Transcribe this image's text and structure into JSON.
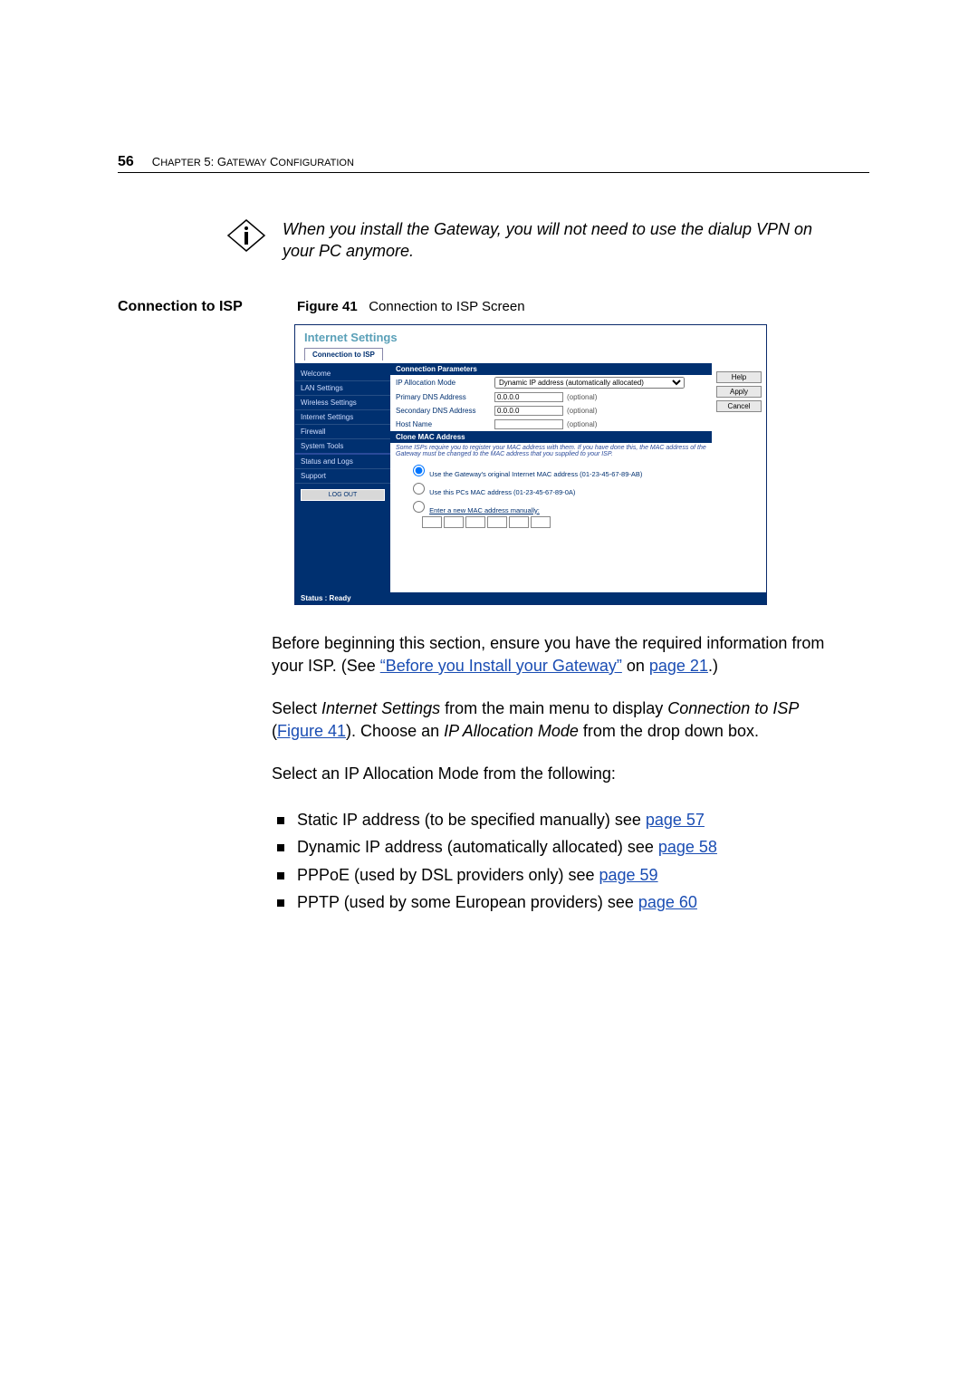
{
  "header": {
    "page_number": "56",
    "chapter_prefix": "C",
    "chapter_rest1": "HAPTER",
    "chapter_num": " 5: G",
    "chapter_rest2": "ATEWAY",
    "chapter_sp": " C",
    "chapter_rest3": "ONFIGURATION"
  },
  "info": {
    "text": "When you install the Gateway, you will not need to use the dialup VPN on your PC anymore."
  },
  "section": {
    "heading": "Connection to ISP",
    "figure_label": "Figure 41",
    "figure_caption": "Connection to ISP Screen"
  },
  "shot": {
    "title": "Internet Settings",
    "tab": "Connection to ISP",
    "sidebar": {
      "items": [
        "Welcome",
        "LAN Settings",
        "Wireless Settings",
        "Internet Settings",
        "Firewall",
        "System Tools"
      ],
      "items2": [
        "Status and Logs",
        "Support"
      ],
      "logout": "LOG OUT"
    },
    "sections": {
      "conn_params": "Connection Parameters",
      "clone_mac": "Clone MAC Address"
    },
    "rows": {
      "ip_mode_lab": "IP Allocation Mode",
      "ip_mode_val": "Dynamic IP address (automatically allocated)",
      "pdns_lab": "Primary DNS Address",
      "pdns_val": "0.0.0.0",
      "sdns_lab": "Secondary DNS Address",
      "sdns_val": "0.0.0.0",
      "host_lab": "Host Name",
      "optional": "(optional)"
    },
    "clone": {
      "note": "Some ISPs require you to register your MAC address with them. If you have done this, the MAC address of the Gateway must be changed to the MAC address that you supplied to your ISP.",
      "r1": "Use the Gateway's original Internet MAC address (01-23-45-67-89-AB)",
      "r2": "Use this PCs MAC address (01-23-45-67-89-0A)",
      "r3": "Enter a new MAC address manually:"
    },
    "buttons": {
      "help": "Help",
      "apply": "Apply",
      "cancel": "Cancel"
    },
    "status": "Status : Ready"
  },
  "body": {
    "p1a": "Before beginning this section, ensure you have the required information from your ISP. (See ",
    "p1_link1": "“Before you Install your Gateway”",
    "p1b": " on ",
    "p1_link2": "page 21",
    "p1c": ".)",
    "p2a": "Select ",
    "p2_i1": "Internet Settings",
    "p2b": " from the main menu to display ",
    "p2_i2": "Connection to ISP",
    "p2c": " (",
    "p2_link": "Figure 41",
    "p2d": "). Choose an ",
    "p2_i3": "IP Allocation Mode",
    "p2e": " from the drop down box.",
    "p3": "Select an IP Allocation Mode from the following:",
    "b1a": "Static IP address (to be specified manually) see ",
    "b1_link": "page 57",
    "b2a": "Dynamic IP address (automatically allocated) see ",
    "b2_link": "page 58",
    "b3a": "PPPoE (used by DSL providers only) see ",
    "b3_link": "page 59",
    "b4a": "PPTP (used by some European providers) see ",
    "b4_link": "page 60"
  }
}
